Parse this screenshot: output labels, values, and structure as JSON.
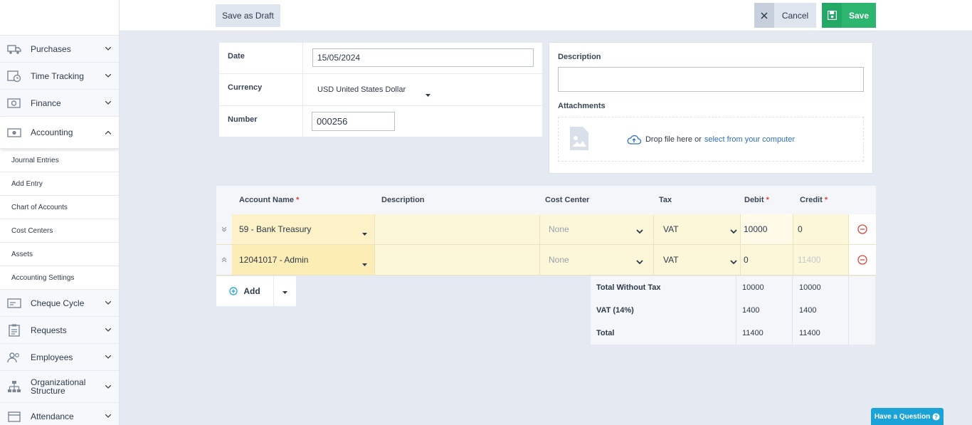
{
  "sidebar": {
    "items": [
      {
        "label": "Purchases",
        "icon": "truck-icon"
      },
      {
        "label": "Time Tracking",
        "icon": "calendar-clock-icon"
      },
      {
        "label": "Finance",
        "icon": "safe-icon"
      },
      {
        "label": "Accounting",
        "icon": "money-icon",
        "expanded": true
      }
    ],
    "sub_items": [
      "Journal Entries",
      "Add Entry",
      "Chart of Accounts",
      "Cost Centers",
      "Assets",
      "Accounting Settings"
    ],
    "items_after": [
      {
        "label": "Cheque Cycle",
        "icon": "cheque-icon"
      },
      {
        "label": "Requests",
        "icon": "clipboard-icon"
      },
      {
        "label": "Employees",
        "icon": "users-icon"
      },
      {
        "label": "Organizational Structure",
        "icon": "org-chart-icon"
      },
      {
        "label": "Attendance",
        "icon": "calendar-icon"
      }
    ]
  },
  "toolbar": {
    "draft_label": "Save as Draft",
    "cancel_label": "Cancel",
    "save_label": "Save"
  },
  "form": {
    "date_label": "Date",
    "date_value": "15/05/2024",
    "currency_label": "Currency",
    "currency_value": "USD United States Dollar",
    "number_label": "Number",
    "number_value": "000256",
    "description_label": "Description",
    "attachments_label": "Attachments",
    "drop_text": "Drop file here or",
    "drop_link": "select from your computer"
  },
  "table": {
    "headers": {
      "account": "Account Name",
      "description": "Description",
      "cost_center": "Cost Center",
      "tax": "Tax",
      "debit": "Debit",
      "credit": "Credit",
      "required_mark": "*"
    },
    "rows": [
      {
        "account": "59 - Bank Treasury",
        "cost_center": "None",
        "tax": "VAT",
        "debit": "10000",
        "credit": "0"
      },
      {
        "account": "12041017 - Admin",
        "cost_center": "None",
        "tax": "VAT",
        "debit": "0",
        "credit": "11400"
      }
    ],
    "add_label": "Add"
  },
  "summary": {
    "rows": [
      {
        "label": "Total Without Tax",
        "debit": "10000",
        "credit": "10000"
      },
      {
        "label": "VAT (14%)",
        "debit": "1400",
        "credit": "1400"
      },
      {
        "label": "Total",
        "debit": "11400",
        "credit": "11400"
      }
    ]
  },
  "help": {
    "label": "Have a Question"
  }
}
